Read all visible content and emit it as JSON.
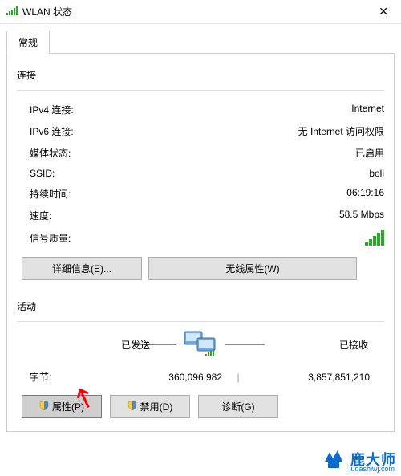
{
  "window": {
    "title": "WLAN 状态",
    "close": "✕"
  },
  "tabs": {
    "general": "常规"
  },
  "connection": {
    "heading": "连接",
    "ipv4_label": "IPv4 连接:",
    "ipv4_value": "Internet",
    "ipv6_label": "IPv6 连接:",
    "ipv6_value": "无 Internet 访问权限",
    "media_label": "媒体状态:",
    "media_value": "已启用",
    "ssid_label": "SSID:",
    "ssid_value": "boli",
    "duration_label": "持续时间:",
    "duration_value": "06:19:16",
    "speed_label": "速度:",
    "speed_value": "58.5 Mbps",
    "signal_label": "信号质量:"
  },
  "buttons": {
    "details": "详细信息(E)...",
    "wireless_props": "无线属性(W)",
    "properties": "属性(P)",
    "disable": "禁用(D)",
    "diagnose": "诊断(G)"
  },
  "activity": {
    "heading": "活动",
    "sent": "已发送",
    "received": "已接收",
    "bytes_label": "字节:",
    "bytes_sent": "360,096,982",
    "bytes_received": "3,857,851,210"
  },
  "watermark": {
    "brand": "鹿大师",
    "url": "ludashiwj.com"
  }
}
